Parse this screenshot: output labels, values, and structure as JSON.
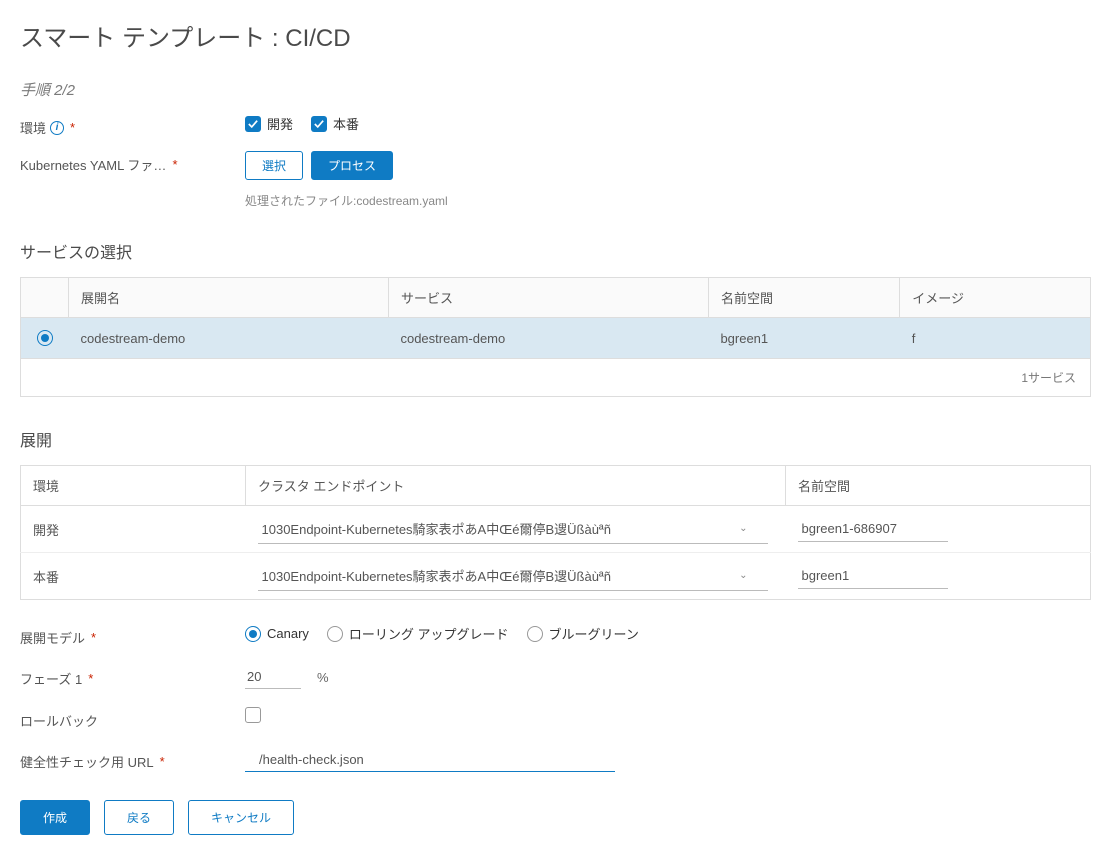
{
  "page": {
    "title": "スマート テンプレート : CI/CD",
    "step": "手順 2/2"
  },
  "environment": {
    "label": "環境",
    "dev": "開発",
    "prod": "本番"
  },
  "yaml": {
    "label": "Kubernetes YAML ファ…",
    "select_btn": "選択",
    "process_btn": "プロセス",
    "processed_prefix": "処理されたファイル:",
    "processed_file": "codestream.yaml"
  },
  "service_section": {
    "title": "サービスの選択",
    "headers": {
      "deploy_name": "展開名",
      "service": "サービス",
      "namespace": "名前空間",
      "image": "イメージ"
    },
    "rows": [
      {
        "deploy_name": "codestream-demo",
        "service": "codestream-demo",
        "namespace": "bgreen1",
        "image": "f"
      }
    ],
    "footer": "1サービス"
  },
  "deploy_section": {
    "title": "展開",
    "headers": {
      "env": "環境",
      "cluster": "クラスタ エンドポイント",
      "namespace": "名前空間"
    },
    "rows": [
      {
        "env": "開発",
        "cluster": "1030Endpoint-Kubernetes騎家表ポあA中Œé爾停B遚Üßàùªñ",
        "namespace": "bgreen1-686907"
      },
      {
        "env": "本番",
        "cluster": "1030Endpoint-Kubernetes騎家表ポあA中Œé爾停B遚Üßàùªñ",
        "namespace": "bgreen1"
      }
    ]
  },
  "deploy_model": {
    "label": "展開モデル",
    "options": {
      "canary": "Canary",
      "rolling": "ローリング アップグレード",
      "bluegreen": "ブルーグリーン"
    }
  },
  "phase": {
    "label": "フェーズ 1",
    "value": "20",
    "unit": "%"
  },
  "rollback": {
    "label": "ロールバック"
  },
  "healthcheck": {
    "label": "健全性チェック用 URL",
    "value": "/health-check.json"
  },
  "actions": {
    "create": "作成",
    "back": "戻る",
    "cancel": "キャンセル"
  }
}
